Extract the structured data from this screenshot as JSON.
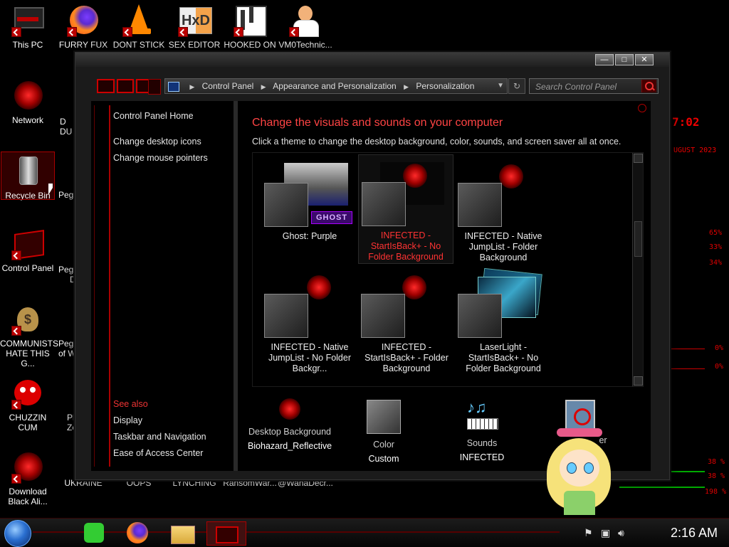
{
  "desktop": {
    "icons": [
      {
        "label": "This PC"
      },
      {
        "label": "FURRY FUX"
      },
      {
        "label": "DONT STICK"
      },
      {
        "label": "SEX EDITOR"
      },
      {
        "label": "HOOKED ON"
      },
      {
        "label": "VM0Technic..."
      },
      {
        "label": "Network"
      },
      {
        "label": "Recycle Bin"
      },
      {
        "label": "Control Panel"
      },
      {
        "label": "COMMUNISTS HATE THIS G..."
      },
      {
        "label": "CHUZZIN CUM"
      },
      {
        "label": "Download Black Ali..."
      },
      {
        "label": "UKRAINE"
      },
      {
        "label": "OOPS"
      },
      {
        "label": "LYNCHING"
      },
      {
        "label": "RansomWar..."
      },
      {
        "label": "@WanaDecr..."
      }
    ],
    "partial_icons": [
      "D",
      "DU",
      "Pegg",
      "Pegg",
      "D",
      "Pega",
      "of W",
      "Pl",
      "Ze"
    ]
  },
  "window": {
    "controls": {
      "minimize": "—",
      "maximize": "□",
      "close": "✕"
    },
    "breadcrumb": [
      "Control Panel",
      "Appearance and Personalization",
      "Personalization"
    ],
    "search_placeholder": "Search Control Panel",
    "left_pane": {
      "home": "Control Panel Home",
      "links": [
        "Change desktop icons",
        "Change mouse pointers"
      ],
      "see_also_heading": "See also",
      "see_also": [
        "Display",
        "Taskbar and Navigation",
        "Ease of Access Center"
      ]
    },
    "main": {
      "title": "Change the visuals and sounds on your computer",
      "subtitle": "Click a theme to change the desktop background, color, sounds, and screen saver all at once.",
      "themes": [
        {
          "label": "Ghost: Purple",
          "logo_text": "GHOST",
          "selected": false
        },
        {
          "label": "INFECTED - StartIsBack+ - No Folder Background",
          "selected": true
        },
        {
          "label": "INFECTED - Native JumpList - Folder Background",
          "selected": false
        },
        {
          "label": "INFECTED - Native JumpList - No Folder Backgr...",
          "selected": false
        },
        {
          "label": "INFECTED - StartIsBack+ - Folder Background",
          "selected": false
        },
        {
          "label": "LaserLight - StartIsBack+ - No Folder Background",
          "selected": false
        }
      ],
      "bottom": [
        {
          "label": "Desktop Background",
          "value": "Biohazard_Reflective"
        },
        {
          "label": "Color",
          "value": "Custom"
        },
        {
          "label": "Sounds",
          "value": "INFECTED"
        },
        {
          "label": "er",
          "value": ""
        }
      ]
    }
  },
  "hud": {
    "clock_partial": "7:02",
    "date_partial": "UGUST 2023",
    "percents": [
      "65%",
      "33%",
      "34%",
      "0%",
      "0%",
      "38 %",
      "38 %",
      "198 %"
    ]
  },
  "taskbar": {
    "clock": "2:16 AM"
  },
  "colors": {
    "accent": "#ff3333",
    "window_bg": "#1b1b1b",
    "content_bg": "#000000"
  }
}
